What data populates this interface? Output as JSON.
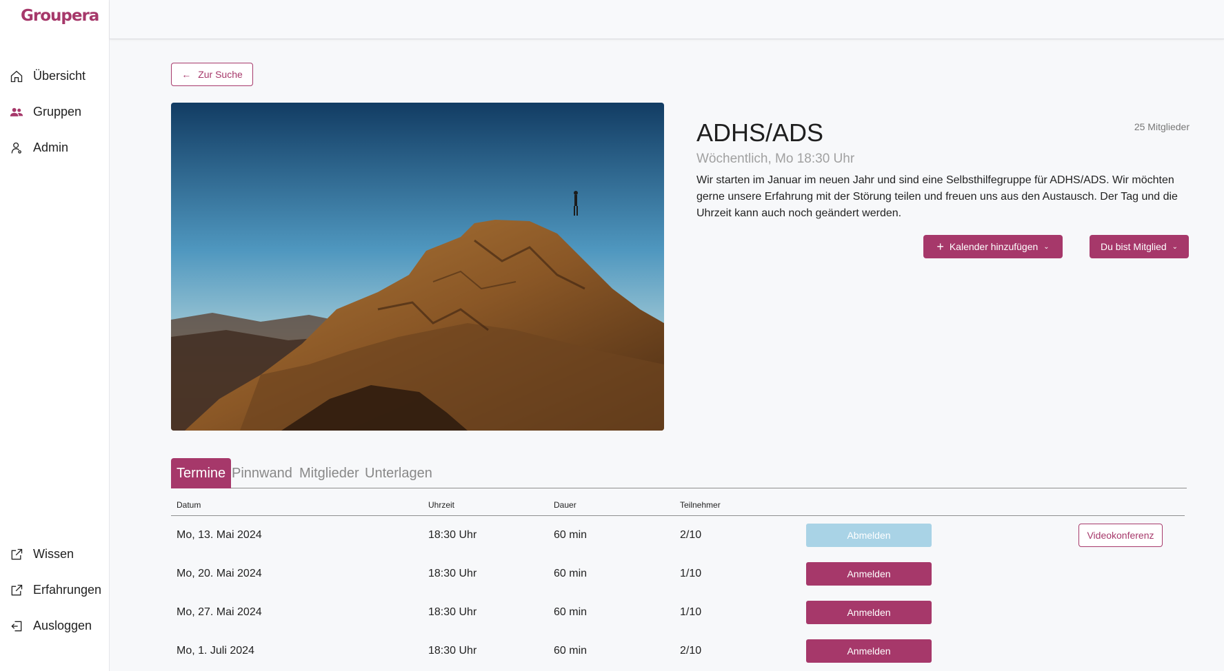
{
  "app": {
    "logo": "Groupera"
  },
  "sidebar": {
    "items": [
      {
        "label": "Übersicht",
        "icon": "home-icon"
      },
      {
        "label": "Gruppen",
        "icon": "users-icon"
      },
      {
        "label": "Admin",
        "icon": "admin-icon"
      }
    ],
    "bottom_items": [
      {
        "label": "Wissen",
        "icon": "external-link-icon"
      },
      {
        "label": "Erfahrungen",
        "icon": "external-link-icon"
      },
      {
        "label": "Ausloggen",
        "icon": "logout-icon"
      }
    ]
  },
  "back_button": {
    "label": "Zur Suche",
    "icon": "arrow-left-icon"
  },
  "group": {
    "title": "ADHS/ADS",
    "members": "25 Mitglieder",
    "schedule": "Wöchentlich, Mo 18:30 Uhr",
    "description": "Wir starten im Januar im neuen Jahr und sind eine Selbsthilfegruppe für ADHS/ADS. Wir möchten gerne unsere Erfahrung mit der Störung teilen und freuen uns aus den Austausch. Der Tag und die Uhrzeit kann auch noch geändert werden.",
    "image": "mountain-summit-photo"
  },
  "actions": {
    "calendar_label": "Kalender hinzufügen",
    "member_label": "Du bist Mitglied"
  },
  "tabs": [
    "Termine",
    "Pinnwand",
    "Mitglieder",
    "Unterlagen"
  ],
  "table": {
    "headers": [
      "Datum",
      "Uhrzeit",
      "Dauer",
      "Teilnehmer"
    ],
    "rows": [
      {
        "date": "Mo, 13. Mai 2024",
        "time": "18:30 Uhr",
        "duration": "60 min",
        "participants": "2/10",
        "action": "Abmelden",
        "video": "Videokonferenz"
      },
      {
        "date": "Mo, 20. Mai 2024",
        "time": "18:30 Uhr",
        "duration": "60 min",
        "participants": "1/10",
        "action": "Anmelden"
      },
      {
        "date": "Mo, 27. Mai 2024",
        "time": "18:30 Uhr",
        "duration": "60 min",
        "participants": "1/10",
        "action": "Anmelden"
      },
      {
        "date": "Mo, 1. Juli 2024",
        "time": "18:30 Uhr",
        "duration": "60 min",
        "participants": "2/10",
        "action": "Anmelden"
      }
    ]
  },
  "colors": {
    "accent": "#a6386a",
    "disabled": "#a9d3e6"
  }
}
